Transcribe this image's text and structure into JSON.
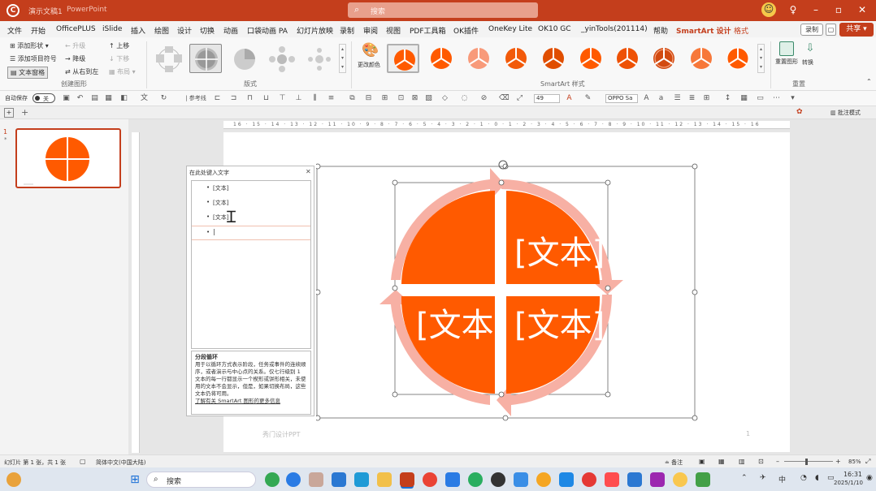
{
  "titlebar": {
    "doc_name": "演示文稿1",
    "app_name": "PowerPoint",
    "search_placeholder": "搜索",
    "logo_letter": "C"
  },
  "tabs": [
    "文件",
    "开始",
    "OfficePLUS",
    "iSlide",
    "插入",
    "绘图",
    "设计",
    "切换",
    "动画",
    "口袋动画 PA",
    "幻灯片放映",
    "录制",
    "审阅",
    "视图",
    "PDF工具箱",
    "OK插件",
    "OneKey Lite",
    "OK10 GC",
    "_yinTools(201114)",
    "帮助",
    "SmartArt 设计",
    "格式"
  ],
  "active_tab": "SmartArt 设计",
  "top_buttons": {
    "record": "录制",
    "share": "共享"
  },
  "ribbon": {
    "create_graphic": {
      "add_shape": "添加形状",
      "add_bullet": "添加项目符号",
      "text_pane": "文本窗格",
      "promote": "升级",
      "demote": "降级",
      "right_to_left": "从右到左",
      "move_up": "上移",
      "move_down": "下移",
      "layout": "布局",
      "label": "创建图形"
    },
    "layouts_label": "版式",
    "change_colors": "更改颜色",
    "styles_label": "SmartArt 样式",
    "reset": {
      "reset_graphic": "重置图形",
      "convert": "转换",
      "label": "重置"
    }
  },
  "qab": {
    "autosave": "自动保存",
    "autosave_state": "关",
    "font_size": "49",
    "font_name": "OPPO Sa"
  },
  "tb2": {
    "notes_label": "批注模式"
  },
  "slide_panel": {
    "number": "1",
    "star": "*"
  },
  "text_pane": {
    "title": "在此处键入文字",
    "items": [
      "[文本]",
      "[文本]",
      "[文本]",
      ""
    ],
    "desc_title": "分段循环",
    "desc_body": "用于以循环方式表示阶段，任务或事件的连续顺序，或者演示与中心点的关系。仅七行级别 1 文本的每一行都显示一个楔形或饼形相关，未使用的文本不会显示，但是，如果切换布局，这些文本仍将可用。",
    "desc_link": "了解有关 SmartArt 图形的更多信息"
  },
  "smartart": {
    "labels": [
      "[文本]",
      "[文本]",
      "[文本]"
    ],
    "fill_color": "#ff5a00",
    "arrow_color": "#f7b0a4"
  },
  "slide_footer": "秀门设计PPT",
  "page_number": "1",
  "status": {
    "slide_info": "幻灯片 第 1 张，共 1 张",
    "language": "简体中文(中国大陆)",
    "notes": "备注",
    "zoom": "85%"
  },
  "taskbar": {
    "search": "搜索",
    "time": "16:31",
    "date": "2025/1/10"
  }
}
